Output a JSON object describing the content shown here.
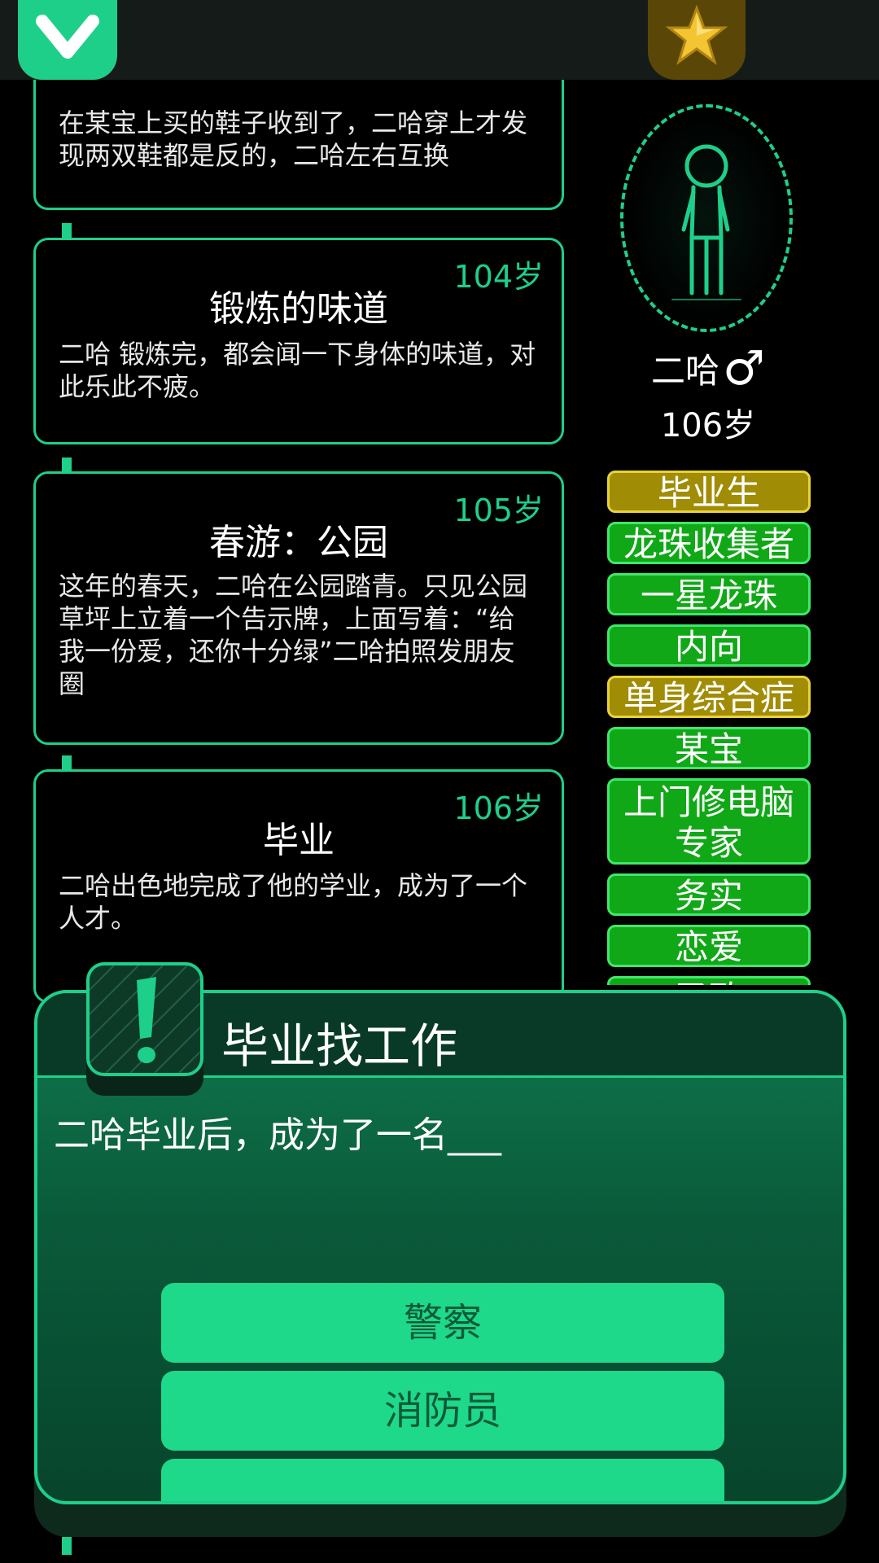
{
  "top_bar": {
    "collapse_icon": "chevron-down-icon",
    "star_icon": "star-icon",
    "accent": "#1ecf8a",
    "star_bg": "#5a4708"
  },
  "timeline": {
    "cards": [
      {
        "age": "",
        "title": "",
        "desc": "在某宝上买的鞋子收到了，二哈穿上才发现两双鞋都是反的，二哈左右互换"
      },
      {
        "age": "104岁",
        "title": "锻炼的味道",
        "desc": "二哈 锻炼完，都会闻一下身体的味道，对此乐此不疲。"
      },
      {
        "age": "105岁",
        "title": "春游：公园",
        "desc": "这年的春天，二哈在公园踏青。只见公园草坪上立着一个告示牌，上面写着：“给我一份爱，还你十分绿”二哈拍照发朋友圈"
      },
      {
        "age": "106岁",
        "title": "毕业",
        "desc": "二哈出色地完成了他的学业，成为了一个人才。"
      }
    ]
  },
  "character": {
    "name": "二哈",
    "gender_symbol": "♂",
    "age": "106岁",
    "avatar_icon": "stick-figure-icon"
  },
  "tags": [
    {
      "label": "毕业生",
      "color": "gold"
    },
    {
      "label": "龙珠收集者",
      "color": "green"
    },
    {
      "label": "一星龙珠",
      "color": "green"
    },
    {
      "label": "内向",
      "color": "green"
    },
    {
      "label": "单身综合症",
      "color": "gold"
    },
    {
      "label": "某宝",
      "color": "green"
    },
    {
      "label": "上门修电脑专家",
      "color": "green"
    },
    {
      "label": "务实",
      "color": "green"
    },
    {
      "label": "恋爱",
      "color": "green"
    },
    {
      "label": "圣致",
      "color": "green"
    }
  ],
  "event": {
    "icon": "exclamation-icon",
    "title": "毕业找工作",
    "text": "二哈毕业后，成为了一名___",
    "choices": [
      "警察",
      "消防员",
      ""
    ]
  }
}
